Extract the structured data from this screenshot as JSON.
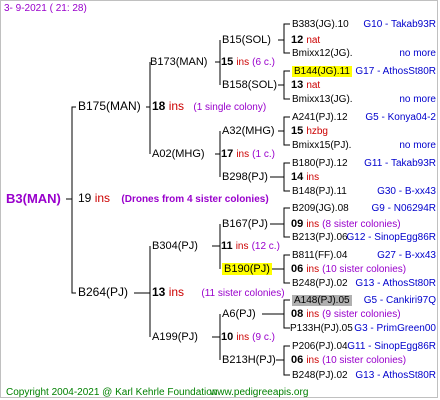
{
  "header": {
    "date": "3-  9-2021 ( 21: 28)"
  },
  "footer": {
    "copyright": "Copyright 2004-2021 @ Karl Kehrle Foundation",
    "site": "www.pedigreeapis.org"
  },
  "root": {
    "name": "B3(MAN)",
    "count": "19",
    "ins": "ins",
    "note": "(Drones from 4 sister colonies)"
  },
  "gen1": {
    "top": {
      "name": "B175(MAN)",
      "count": "18",
      "ins": "ins",
      "note": "(1 single colony)"
    },
    "bottom": {
      "name": "B264(PJ)",
      "count": "13",
      "ins": "ins",
      "note": "(11 sister colonies)"
    }
  },
  "gen2": [
    {
      "name": "B173(MAN)",
      "count": "15",
      "ins": "ins",
      "note": "(6 c.)"
    },
    {
      "name": "A02(MHG)",
      "count": "17",
      "ins": "ins",
      "note": "(1 c.)"
    },
    {
      "name": "B304(PJ)",
      "count": "11",
      "ins": "ins",
      "note": "(12 c.)"
    },
    {
      "name": "A199(PJ)",
      "count": "10",
      "ins": "ins",
      "note": "(9 c.)"
    }
  ],
  "gen3": [
    {
      "name": "B15(SOL)",
      "count": "12",
      "ins": "nat"
    },
    {
      "name": "B158(SOL)",
      "count": "13",
      "ins": "nat"
    },
    {
      "name": "A32(MHG)",
      "count": "15",
      "ins": "hzbg"
    },
    {
      "name": "B298(PJ)",
      "count": "14",
      "ins": "ins"
    },
    {
      "name": "B167(PJ)",
      "count": "09",
      "ins": "ins",
      "note": "(8 sister colonies)"
    },
    {
      "name": "B190(PJ)",
      "count": "06",
      "ins": "ins",
      "note": "(10 sister colonies)"
    },
    {
      "name": "A6(PJ)",
      "count": "08",
      "ins": "ins",
      "note": "(9 sister colonies)"
    },
    {
      "name": "B213H(PJ)",
      "count": "06",
      "ins": "ins",
      "note": "(10 sister colonies)"
    }
  ],
  "gen4": [
    {
      "name": "B383(JG).10",
      "right": "G10 - Takab93R"
    },
    {
      "name": "Bmixx12(JG).",
      "right": "no more"
    },
    {
      "name": "B144(JG).11",
      "right": "G17 - AthosSt80R"
    },
    {
      "name": "Bmixx13(JG).",
      "right": "no more"
    },
    {
      "name": "A241(PJ).12",
      "right": "G5 - Konya04-2"
    },
    {
      "name": "Bmixx15(PJ).",
      "right": "no more"
    },
    {
      "name": "B180(PJ).12",
      "right": "G11 - Takab93R"
    },
    {
      "name": "B148(PJ).11",
      "right": "G30 - B-xx43"
    },
    {
      "name": "B209(JG).08",
      "right": "G9 - N06294R"
    },
    {
      "name": "B213(PJ).06",
      "right": "G12 - SinopEgg86R"
    },
    {
      "name": "B811(FF).04",
      "right": "G27 - B-xx43"
    },
    {
      "name": "B248(PJ).02",
      "right": "G13 - AthosSt80R"
    },
    {
      "name": "A148(PJ).05",
      "right": "G5 - Cankiri97Q"
    },
    {
      "name": "P133H(PJ).05",
      "right": "G3 - PrimGreen00"
    },
    {
      "name": "P206(PJ).04",
      "right": "G11 - SinopEgg86R"
    },
    {
      "name": "B248(PJ).02",
      "right": "G13 - AthosSt80R"
    }
  ]
}
